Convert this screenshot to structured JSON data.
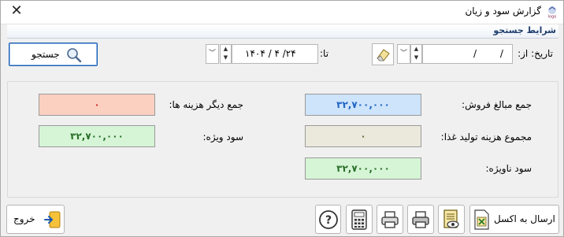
{
  "window": {
    "title": "گزارش سود و زیان"
  },
  "search": {
    "section_title": "شرایط جستجو",
    "date_from_label": "تاریخ: از:",
    "date_from_value": "/ /",
    "date_to_label": "تا:",
    "date_to_value": "۱۴۰۴ / ۴ /۲۴",
    "search_button": "جستجو"
  },
  "summary": {
    "total_sales_label": "جمع مبالغ فروش:",
    "total_sales_value": "۳۲,۷۰۰,۰۰۰",
    "food_cost_label": "مجموع هزینه تولید غذا:",
    "food_cost_value": "۰",
    "gross_profit_label": "سود ناویژه:",
    "gross_profit_value": "۳۲,۷۰۰,۰۰۰",
    "other_costs_label": "جمع دیگر هزینه ها:",
    "other_costs_value": "۰",
    "net_profit_label": "سود ویژه:",
    "net_profit_value": "۳۲,۷۰۰,۰۰۰"
  },
  "toolbar": {
    "exit_button": "خروج",
    "excel_button": "ارسال به اکسل"
  },
  "colors": {
    "sales_field": "#cde4fb",
    "green_field": "#d6f5d6",
    "other_costs_field": "#fbd0c0",
    "food_cost_field": "#ebe9dc",
    "section_title": "#1f3f6e"
  }
}
